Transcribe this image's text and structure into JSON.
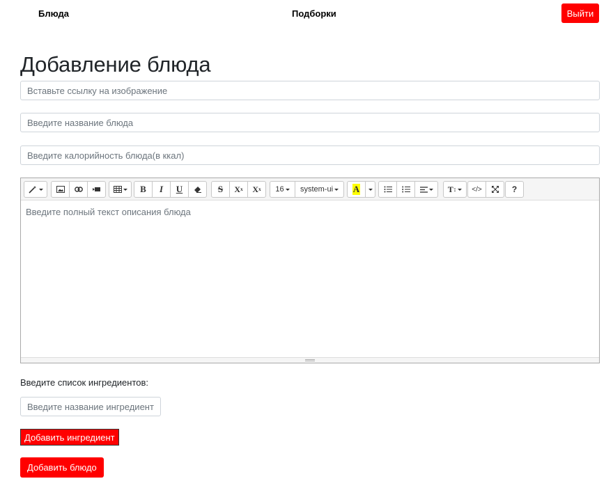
{
  "nav": {
    "dishes": "Блюда",
    "collections": "Подборки",
    "logout": "Выйти"
  },
  "page": {
    "title": "Добавление блюда"
  },
  "form": {
    "image_placeholder": "Вставьте ссылку на изображение",
    "name_placeholder": "Введите название блюда",
    "calories_placeholder": "Введите калорийность блюда(в ккал)",
    "description_placeholder": "Введите полный текст описания блюда",
    "ingredients_label": "Введите список ингредиентов:",
    "ingredient_placeholder": "Введите название ингредиента",
    "add_ingredient": "Добавить ингредиент",
    "add_dish": "Добавить блюдо"
  },
  "editor": {
    "font_size": "16",
    "font_family": "system-ui",
    "bold": "B",
    "italic": "I",
    "underline": "U",
    "strike": "S",
    "superscript": "X",
    "subscript": "X",
    "color": "A",
    "help": "?",
    "code": "</>",
    "height": "T",
    "icons": [
      "magic-icon",
      "picture-icon",
      "link-icon",
      "video-icon",
      "table-icon",
      "eraser-icon",
      "unordered-list-icon",
      "ordered-list-icon",
      "align-icon",
      "fullscreen-icon"
    ],
    "accent_highlight": "#ffff00"
  },
  "colors": {
    "accent": "#ff0000"
  }
}
